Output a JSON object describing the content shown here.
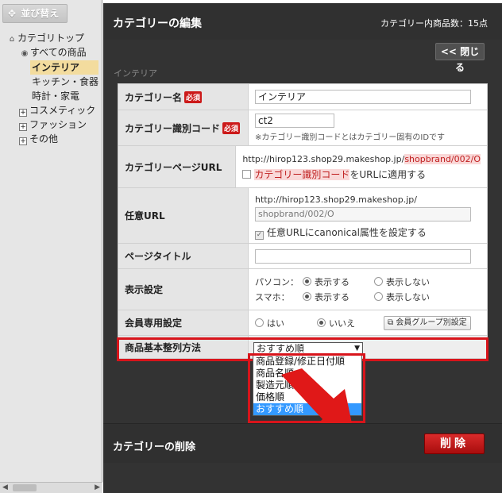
{
  "sidebar": {
    "sort_button": "並び替え",
    "tree": [
      {
        "label": "カテゴリトップ",
        "kind": "home-icon"
      },
      {
        "label": "すべての商品",
        "kind": "radio-icon"
      },
      {
        "label": "インテリア",
        "kind": "selected"
      },
      {
        "label": "キッチン・食器",
        "kind": "leaf"
      },
      {
        "label": "時計・家電",
        "kind": "leaf"
      },
      {
        "label": "コスメティック",
        "kind": "expand"
      },
      {
        "label": "ファッション",
        "kind": "expand"
      },
      {
        "label": "その他",
        "kind": "expand"
      }
    ],
    "expand_symbol": "+"
  },
  "header": {
    "title": "カテゴリーの編集",
    "count_label": "カテゴリー内商品数：15点",
    "close_button": "閉じる",
    "close_glyph": "<<"
  },
  "breadcrumb": "インテリア",
  "form": {
    "required_badge": "必須",
    "name": {
      "label": "カテゴリー名",
      "value": "インテリア"
    },
    "code": {
      "label": "カテゴリー識別コード",
      "value": "ct2",
      "note": "※カテゴリー識別コードとはカテゴリー固有のIDです"
    },
    "page_url": {
      "label": "カテゴリーページURL",
      "url_prefix": "http://hirop123.shop29.makeshop.jp/",
      "url_suffix": "shopbrand/002/O",
      "checkbox_hl": "カテゴリー識別コード",
      "checkbox_rest": "をURLに適用する"
    },
    "custom_url": {
      "label": "任意URL",
      "url_prefix": "http://hirop123.shop29.makeshop.jp/",
      "value": "shopbrand/002/O",
      "checkbox_label": "任意URLにcanonical属性を設定する",
      "check_mark": "✓"
    },
    "page_title": {
      "label": "ページタイトル",
      "value": ""
    },
    "display": {
      "label": "表示設定",
      "pc": "パソコン：",
      "phone": "スマホ：",
      "show": "表示する",
      "hide": "表示しない"
    },
    "member": {
      "label": "会員専用設定",
      "yes": "はい",
      "no": "いいえ",
      "group_button": "会員グループ別設定"
    },
    "sort": {
      "label": "商品基本整列方法",
      "selected": "おすすめ順",
      "options": [
        "商品登録/修正日付順",
        "商品名順",
        "製造元順",
        "価格順",
        "おすすめ順"
      ]
    }
  },
  "delete": {
    "title": "カテゴリーの削除",
    "button": "削除"
  },
  "colors": {
    "accent_red": "#d8141b",
    "selection_blue": "#3399ff",
    "dark_panel": "#333333"
  }
}
